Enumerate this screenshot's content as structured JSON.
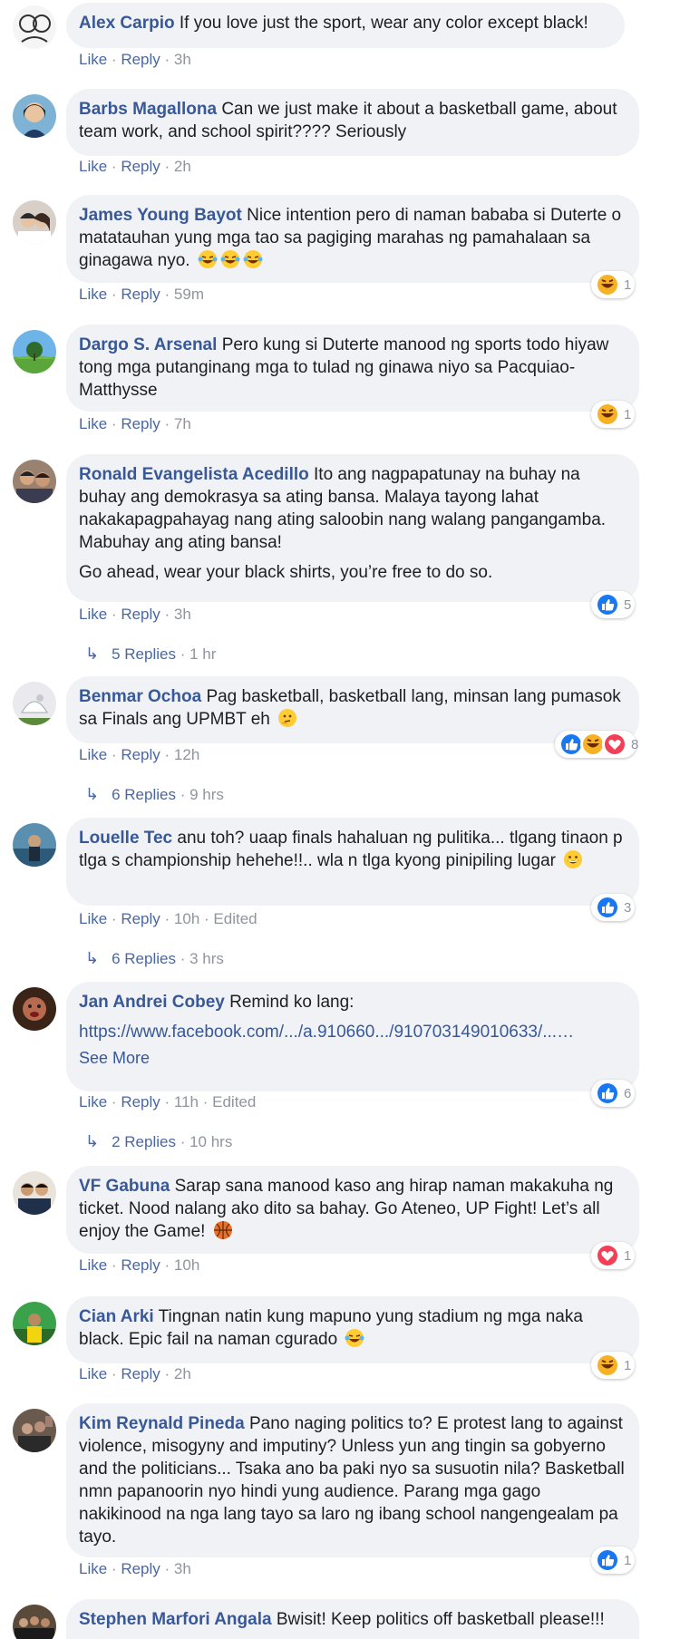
{
  "comments": [
    {
      "author": "Alex Carpio",
      "text": "If you love just the sport, wear any color except black!",
      "like": "Like",
      "reply": "Reply",
      "time": "3h"
    },
    {
      "author": "Barbs Magallona",
      "text": "Can we just make it about a basketball game, about team work, and school spirit???? Seriously",
      "like": "Like",
      "reply": "Reply",
      "time": "2h"
    },
    {
      "author": "James Young Bayot",
      "text": "Nice intention pero di naman bababa si Duterte o matatauhan yung mga tao sa pagiging marahas ng pamahalaan sa ginagawa nyo.",
      "emojis": [
        "laughing-tears-emoji",
        "laughing-tears-emoji",
        "laughing-tears-emoji"
      ],
      "like": "Like",
      "reply": "Reply",
      "time": "59m",
      "reactions": {
        "icons": [
          "haha-reaction-icon"
        ],
        "count": "1"
      }
    },
    {
      "author": "Dargo S. Arsenal",
      "text": "Pero kung si Duterte manood ng sports todo hiyaw tong mga putanginang mga to tulad ng ginawa niyo sa Pacquiao-Matthysse",
      "like": "Like",
      "reply": "Reply",
      "time": "7h",
      "reactions": {
        "icons": [
          "haha-reaction-icon"
        ],
        "count": "1"
      }
    },
    {
      "author": "Ronald Evangelista Acedillo",
      "text": "Ito ang nagpapatunay na buhay na buhay ang demokrasya sa ating bansa. Malaya tayong lahat nakakapagpahayag nang ating saloobin nang walang pangangamba. Mabuhay ang ating bansa!",
      "text2": "Go ahead, wear your black shirts, you’re free to do so.",
      "like": "Like",
      "reply": "Reply",
      "time": "3h",
      "reactions": {
        "icons": [
          "like-reaction-icon"
        ],
        "count": "5"
      },
      "replies": {
        "label": "5 Replies",
        "time": "1 hr"
      }
    },
    {
      "author": "Benmar Ochoa",
      "text": "Pag basketball, basketball lang, minsan lang pumasok sa Finals ang UPMBT eh",
      "emojis": [
        "thinking-face-emoji"
      ],
      "like": "Like",
      "reply": "Reply",
      "time": "12h",
      "reactions": {
        "icons": [
          "like-reaction-icon",
          "haha-reaction-icon",
          "love-reaction-icon"
        ],
        "count": "8"
      },
      "replies": {
        "label": "6 Replies",
        "time": "9 hrs"
      }
    },
    {
      "author": "Louelle Tec",
      "text": "anu toh? uaap finals hahaluan ng pulitika... tlgang tinaon p tlga s championship hehehe!!.. wla n tlga kyong pinipiling lugar",
      "emojis": [
        "grinning-face-emoji"
      ],
      "like": "Like",
      "reply": "Reply",
      "time": "10h",
      "edited": "Edited",
      "reactions": {
        "icons": [
          "like-reaction-icon"
        ],
        "count": "3"
      },
      "replies": {
        "label": "6 Replies",
        "time": "3 hrs"
      }
    },
    {
      "author": "Jan Andrei Cobey",
      "text": "Remind ko lang:",
      "link": "https://www.facebook.com/.../a.910660.../910703149010633/...…",
      "see_more": "See More",
      "like": "Like",
      "reply": "Reply",
      "time": "11h",
      "edited": "Edited",
      "reactions": {
        "icons": [
          "like-reaction-icon"
        ],
        "count": "6"
      },
      "replies": {
        "label": "2 Replies",
        "time": "10 hrs"
      }
    },
    {
      "author": "VF Gabuna",
      "text": "Sarap sana manood kaso ang hirap naman makakuha ng ticket. Nood nalang ako dito sa bahay. Go Ateneo, UP Fight! Let’s all enjoy the Game!",
      "emojis": [
        "basketball-emoji"
      ],
      "like": "Like",
      "reply": "Reply",
      "time": "10h",
      "reactions": {
        "icons": [
          "love-reaction-icon"
        ],
        "count": "1"
      }
    },
    {
      "author": "Cian Arki",
      "text": "Tingnan natin kung mapuno yung stadium ng mga naka black. Epic fail na naman cgurado",
      "emojis": [
        "laughing-tears-emoji"
      ],
      "like": "Like",
      "reply": "Reply",
      "time": "2h",
      "reactions": {
        "icons": [
          "haha-reaction-icon"
        ],
        "count": "1"
      }
    },
    {
      "author": "Kim Reynald Pineda",
      "text": "Pano naging politics to? E protest lang to against violence, misogyny and imputiny? Unless yun ang tingin sa gobyerno and the politicians... Tsaka ano ba paki nyo sa susuotin nila? Basketball nmn papanoorin nyo hindi yung audience. Parang mga gago nakikinood na nga lang tayo sa laro ng ibang school nangengealam pa tayo.",
      "like": "Like",
      "reply": "Reply",
      "time": "3h",
      "reactions": {
        "icons": [
          "like-reaction-icon"
        ],
        "count": "1"
      }
    },
    {
      "author": "Stephen Marfori Angala",
      "text": "Bwisit! Keep politics off basketball please!!!"
    }
  ],
  "colors": {
    "bubble": "#f0f2f5",
    "author": "#385898",
    "action": "#4b67a1",
    "meta": "#90949c",
    "like_blue": "#1877f2",
    "love_red": "#f33e58",
    "haha_yellow": "#f7b125"
  }
}
